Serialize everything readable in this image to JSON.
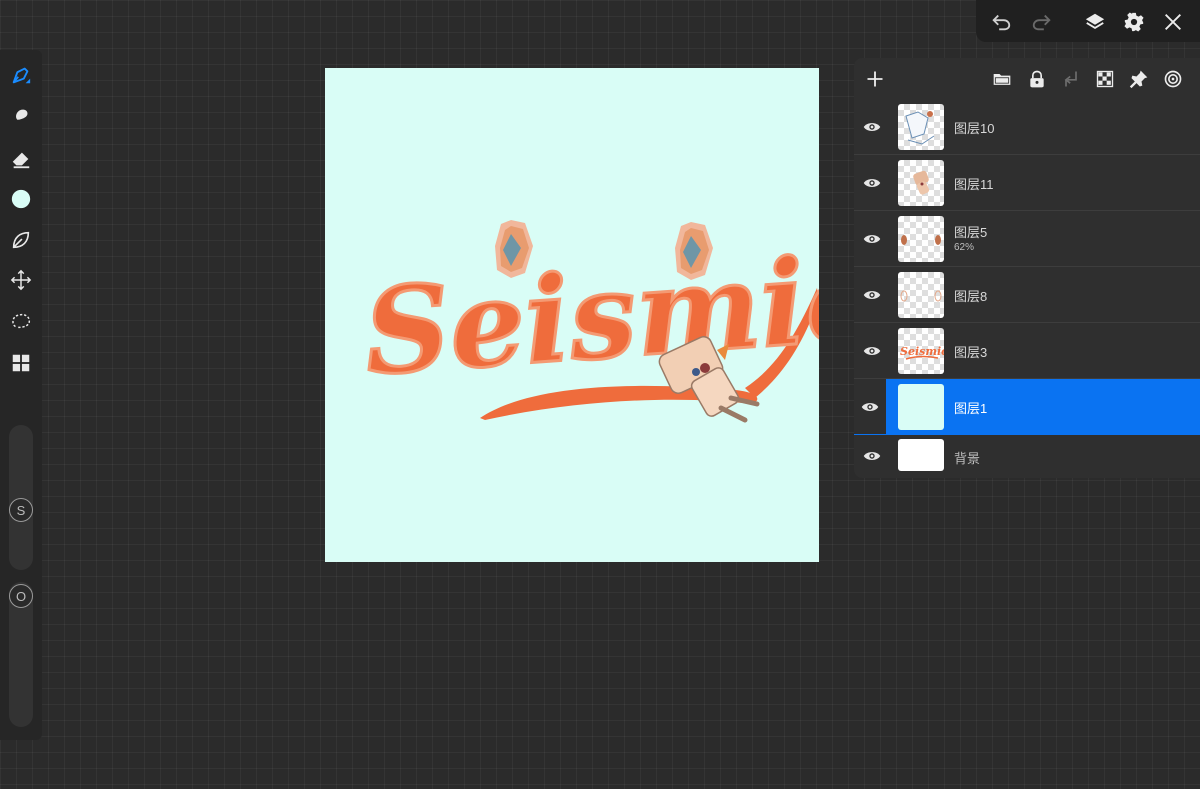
{
  "colors": {
    "accent": "#0a73f2",
    "canvas_background": "#d9fdf6",
    "brush_color": "#d9fdf6",
    "lettering_orange": "#ef6c3c"
  },
  "toolbar": {
    "tools": [
      {
        "name": "brush-icon"
      },
      {
        "name": "smudge-icon"
      },
      {
        "name": "eraser-icon"
      },
      {
        "name": "color-swatch"
      },
      {
        "name": "leaf-icon"
      },
      {
        "name": "move-icon"
      },
      {
        "name": "lasso-icon"
      },
      {
        "name": "grid-icon"
      }
    ],
    "size_slider_label": "S",
    "opacity_slider_label": "O"
  },
  "topbar": {
    "buttons": [
      "undo-icon",
      "redo-icon",
      "layers-icon",
      "settings-icon",
      "close-icon"
    ]
  },
  "artwork": {
    "text": "Seismic"
  },
  "layers_panel": {
    "header_buttons": [
      "add-layer-icon",
      "folder-icon",
      "lock-icon",
      "merge-down-icon",
      "checker-icon",
      "pin-icon",
      "spiral-icon"
    ],
    "layers": [
      {
        "name": "图层10",
        "opacity": ""
      },
      {
        "name": "图层11",
        "opacity": ""
      },
      {
        "name": "图层5",
        "opacity": "62%"
      },
      {
        "name": "图层8",
        "opacity": ""
      },
      {
        "name": "图层3",
        "opacity": ""
      },
      {
        "name": "图层1",
        "opacity": "",
        "selected": true
      },
      {
        "name": "背景",
        "opacity": ""
      }
    ],
    "thumbnail_text": "Seismic"
  }
}
